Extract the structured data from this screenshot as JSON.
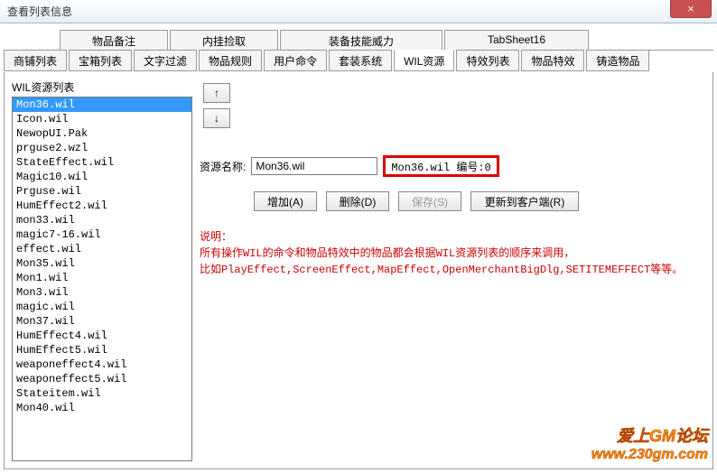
{
  "window": {
    "title": "查看列表信息",
    "close": "×"
  },
  "tabs_top": [
    {
      "label": "物品备注"
    },
    {
      "label": "内挂捡取"
    },
    {
      "label": "装备技能威力"
    },
    {
      "label": "TabSheet16"
    }
  ],
  "tabs_bottom": [
    {
      "label": "商铺列表"
    },
    {
      "label": "宝箱列表"
    },
    {
      "label": "文字过滤"
    },
    {
      "label": "物品规则"
    },
    {
      "label": "用户命令"
    },
    {
      "label": "套装系统"
    },
    {
      "label": "WIL资源",
      "active": true
    },
    {
      "label": "特效列表"
    },
    {
      "label": "物品特效"
    },
    {
      "label": "铸造物品"
    }
  ],
  "left": {
    "caption": "WIL资源列表",
    "items": [
      {
        "name": "Mon36.wil",
        "selected": true
      },
      {
        "name": "Icon.wil"
      },
      {
        "name": "NewopUI.Pak"
      },
      {
        "name": "prguse2.wzl"
      },
      {
        "name": "StateEffect.wil"
      },
      {
        "name": "Magic10.wil"
      },
      {
        "name": "Prguse.wil"
      },
      {
        "name": "HumEffect2.wil"
      },
      {
        "name": "mon33.wil"
      },
      {
        "name": "magic7-16.wil"
      },
      {
        "name": "effect.wil"
      },
      {
        "name": "Mon35.wil"
      },
      {
        "name": "Mon1.wil"
      },
      {
        "name": "Mon3.wil"
      },
      {
        "name": "magic.wil"
      },
      {
        "name": "Mon37.wil"
      },
      {
        "name": "HumEffect4.wil"
      },
      {
        "name": "HumEffect5.wil"
      },
      {
        "name": "weaponeffect4.wil"
      },
      {
        "name": "weaponeffect5.wil"
      },
      {
        "name": "Stateitem.wil"
      },
      {
        "name": "Mon40.wil"
      }
    ]
  },
  "arrows": {
    "up": "↑",
    "down": "↓"
  },
  "form": {
    "name_label": "资源名称:",
    "name_value": "Mon36.wil",
    "info_text": "Mon36.wil 编号:0"
  },
  "buttons": {
    "add": "增加(A)",
    "del": "删除(D)",
    "save": "保存(S)",
    "update": "更新到客户端(R)"
  },
  "desc": {
    "heading": "说明：",
    "line1": "所有操作WIL的命令和物品特效中的物品都会根据WIL资源列表的顺序来调用，",
    "line2": "比如PlayEffect,ScreenEffect,MapEffect,OpenMerchantBigDlg,SETITEMEFFECT等等。"
  },
  "watermark": {
    "line1": "爱上GM论坛",
    "line2": "www.230gm.com"
  }
}
